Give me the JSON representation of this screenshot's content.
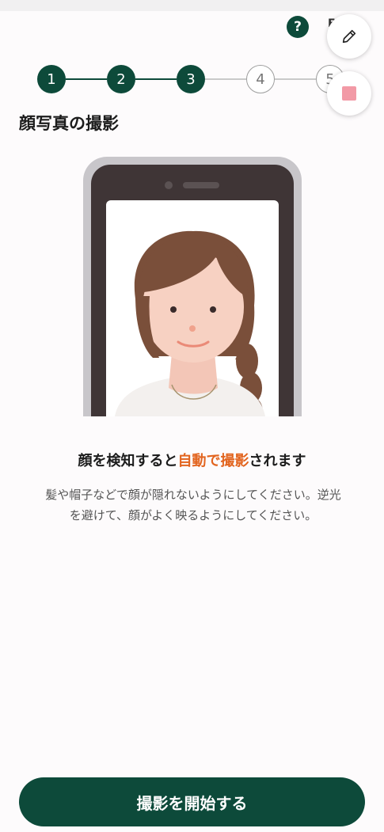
{
  "header": {
    "help_label": "?",
    "partial_glyph": "F"
  },
  "stepper": {
    "steps": [
      "1",
      "2",
      "3",
      "4",
      "5"
    ],
    "current_step": 3
  },
  "page_title": "顔写真の撮影",
  "illustration": {
    "icon": "phone-selfie-illustration"
  },
  "headline": {
    "before": "顔を検知すると",
    "accent": "自動で撮影",
    "after": "されます"
  },
  "description": {
    "line1": "髪や帽子などで顔が隠れないようにしてください。逆光",
    "line2": "を避けて、顔がよく映るようにしてください。"
  },
  "start_button_label": "撮影を開始する",
  "colors": {
    "primary": "#0d4a3a",
    "accent": "#e2641e",
    "stop": "#f29aa6"
  }
}
